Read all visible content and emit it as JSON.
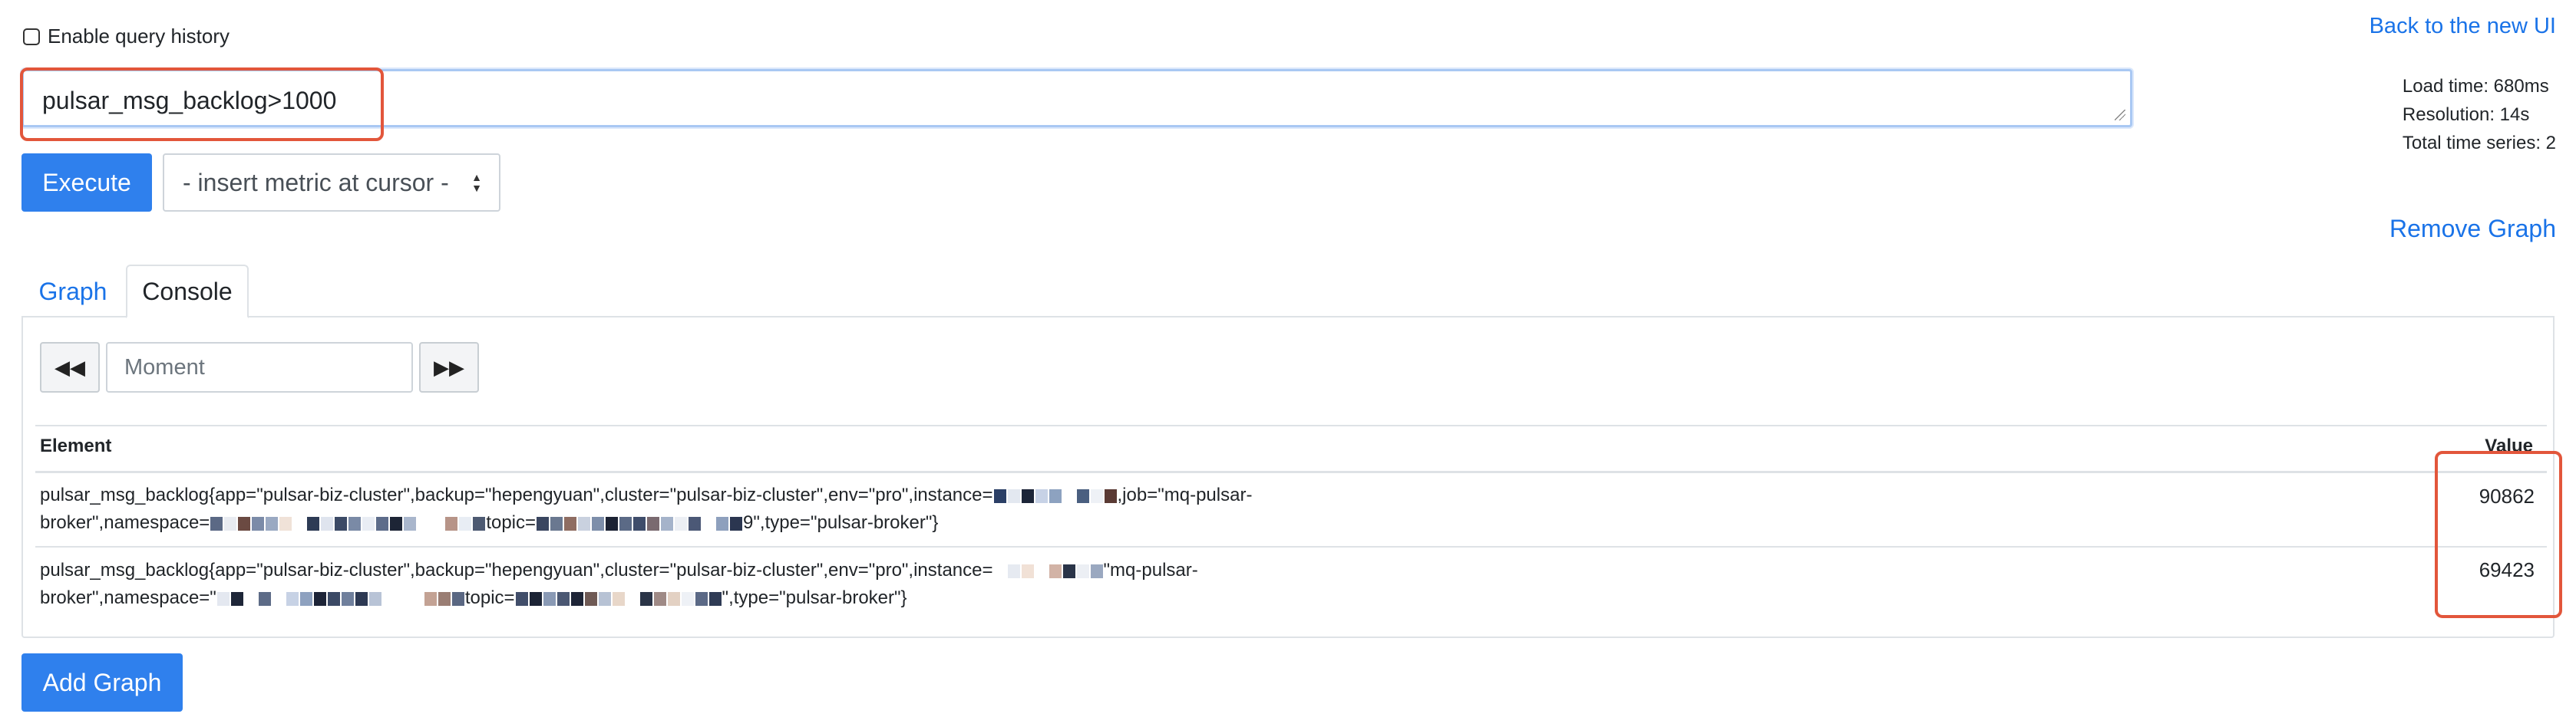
{
  "query_history": {
    "label": "Enable query history"
  },
  "links": {
    "back_new_ui": "Back to the new UI",
    "remove_graph": "Remove Graph"
  },
  "expression": {
    "value": "pulsar_msg_backlog>1000"
  },
  "stats": {
    "load_time": "Load time: 680ms",
    "resolution": "Resolution: 14s",
    "total_series": "Total time series: 2"
  },
  "controls": {
    "execute": "Execute",
    "insert_metric": "- insert metric at cursor -",
    "add_graph": "Add Graph"
  },
  "tabs": {
    "graph": "Graph",
    "console": "Console"
  },
  "moment": {
    "placeholder": "Moment"
  },
  "table": {
    "headers": {
      "element": "Element",
      "value": "Value"
    },
    "rows": [
      {
        "line1": "pulsar_msg_backlog{app=\"pulsar-biz-cluster\",backup=\"hepengyuan\",cluster=\"pulsar-biz-cluster\",env=\"pro\",instance=",
        "line1_tail": ",job=\"mq-pulsar-",
        "line2_head": "broker\",namespace=",
        "line2_mid": "topic=",
        "line2_tail": "9\",type=\"pulsar-broker\"}",
        "value": "90862"
      },
      {
        "line1": "pulsar_msg_backlog{app=\"pulsar-biz-cluster\",backup=\"hepengyuan\",cluster=\"pulsar-biz-cluster\",env=\"pro\",instance=",
        "line1_tail": "\"mq-pulsar-",
        "line2_head": "broker\",namespace=\"",
        "line2_mid": "topic=",
        "line2_tail": "\",type=\"pulsar-broker\"}",
        "value": "69423"
      }
    ]
  },
  "colors": {
    "accent": "#2f80ed",
    "link": "#1a73e8",
    "highlight": "#e2563b"
  }
}
